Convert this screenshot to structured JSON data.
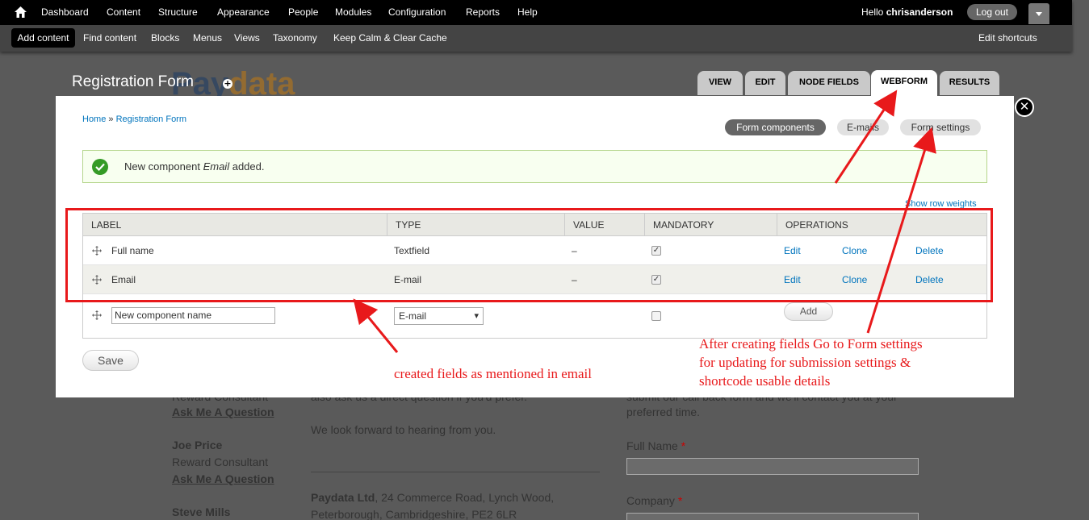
{
  "toolbar": {
    "main_items": [
      "Dashboard",
      "Content",
      "Structure",
      "Appearance",
      "People",
      "Modules",
      "Configuration",
      "Reports",
      "Help"
    ],
    "greeting": "Hello",
    "username": "chrisanderson",
    "logout_label": "Log out",
    "shortcuts": [
      "Add content",
      "Find content",
      "Blocks",
      "Menus",
      "Views",
      "Taxonomy",
      "Keep Calm & Clear Cache"
    ],
    "edit_shortcuts": "Edit shortcuts"
  },
  "page": {
    "title": "Registration Form",
    "logo_a": "Pay",
    "logo_b": "data",
    "tabs": [
      "VIEW",
      "EDIT",
      "NODE FIELDS",
      "WEBFORM",
      "RESULTS"
    ],
    "active_tab": "WEBFORM"
  },
  "background": {
    "line1": "Reward Consultant",
    "ask1": "Ask Me A Question",
    "name2": "Joe Price",
    "role2": "Reward Consultant",
    "ask2": "Ask Me A Question",
    "name3": "Steve Mills",
    "mid1": "also ask us a direct question if you'd prefer.",
    "mid2": "We look forward to hearing from you.",
    "company": "Paydata Ltd",
    "address1": ", 24 Commerce Road, Lynch Wood,",
    "address2": "Peterborough, Cambridgeshire, PE2 6LR",
    "right1": "submit our call back form and we'll contact you at your",
    "right2": "preferred time.",
    "field1": "Full Name",
    "field2": "Company",
    "required_mark": "*"
  },
  "overlay": {
    "close_glyph": "✕",
    "breadcrumb": {
      "home": "Home",
      "sep": "»",
      "current": "Registration Form"
    },
    "subtabs": [
      "Form components",
      "E-mails",
      "Form settings"
    ],
    "message_prefix": "New component",
    "message_component": "Email",
    "message_suffix": "added.",
    "show_row_weights": "Show row weights",
    "table": {
      "headers": [
        "Label",
        "Type",
        "Value",
        "Mandatory",
        "Operations"
      ],
      "rows": [
        {
          "label": "Full name",
          "type": "Textfield",
          "value": "–",
          "mandatory": true,
          "ops": [
            "Edit",
            "Clone",
            "Delete"
          ]
        },
        {
          "label": "Email",
          "type": "E-mail",
          "value": "–",
          "mandatory": true,
          "ops": [
            "Edit",
            "Clone",
            "Delete"
          ]
        }
      ],
      "new_row": {
        "name_value": "New component name",
        "type_value": "E-mail",
        "add_label": "Add"
      }
    },
    "save_label": "Save"
  },
  "annotations": {
    "fields_note": "created fields as mentioned in email",
    "settings_note_1": "After creating fields Go to Form settings",
    "settings_note_2": "for updating for submission settings &",
    "settings_note_3": "shortcode usable details"
  },
  "colors": {
    "accent_red": "#e8191b",
    "link": "#0074bd",
    "success": "#359b26"
  }
}
